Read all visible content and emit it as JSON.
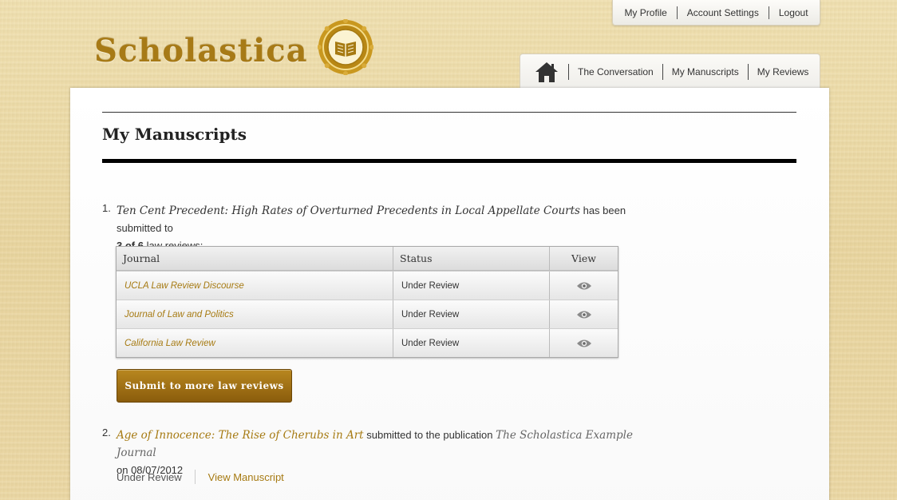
{
  "brand": {
    "name": "Scholastica",
    "accent": "#a67a12"
  },
  "top_links": [
    "My Profile",
    "Account Settings",
    "Logout"
  ],
  "nav": {
    "home_icon": "home-icon",
    "tabs": [
      "The Conversation",
      "My Manuscripts",
      "My Reviews"
    ]
  },
  "page": {
    "title": "My Manuscripts"
  },
  "manuscripts": [
    {
      "number": "1.",
      "title": "Ten Cent Precedent: High Rates of Overturned Precedents in Local Appellate Courts",
      "text_after_title": " has been submitted to",
      "count": "3 of 6",
      "text_after_count": " law reviews:",
      "table": {
        "headers": [
          "Journal",
          "Status",
          "View"
        ],
        "rows": [
          {
            "journal": "UCLA Law Review Discourse",
            "status": "Under Review"
          },
          {
            "journal": "Journal of Law and Politics",
            "status": "Under Review"
          },
          {
            "journal": "California Law Review",
            "status": "Under Review"
          }
        ]
      },
      "button": "Submit to more law reviews"
    },
    {
      "number": "2.",
      "title": "Age of Innocence: The Rise of Cherubs in Art",
      "text_after_title": " submitted to the publication ",
      "publication": "The Scholastica Example Journal",
      "date_line": "on 08/07/2012",
      "status": "Under Review",
      "link": "View Manuscript"
    }
  ]
}
